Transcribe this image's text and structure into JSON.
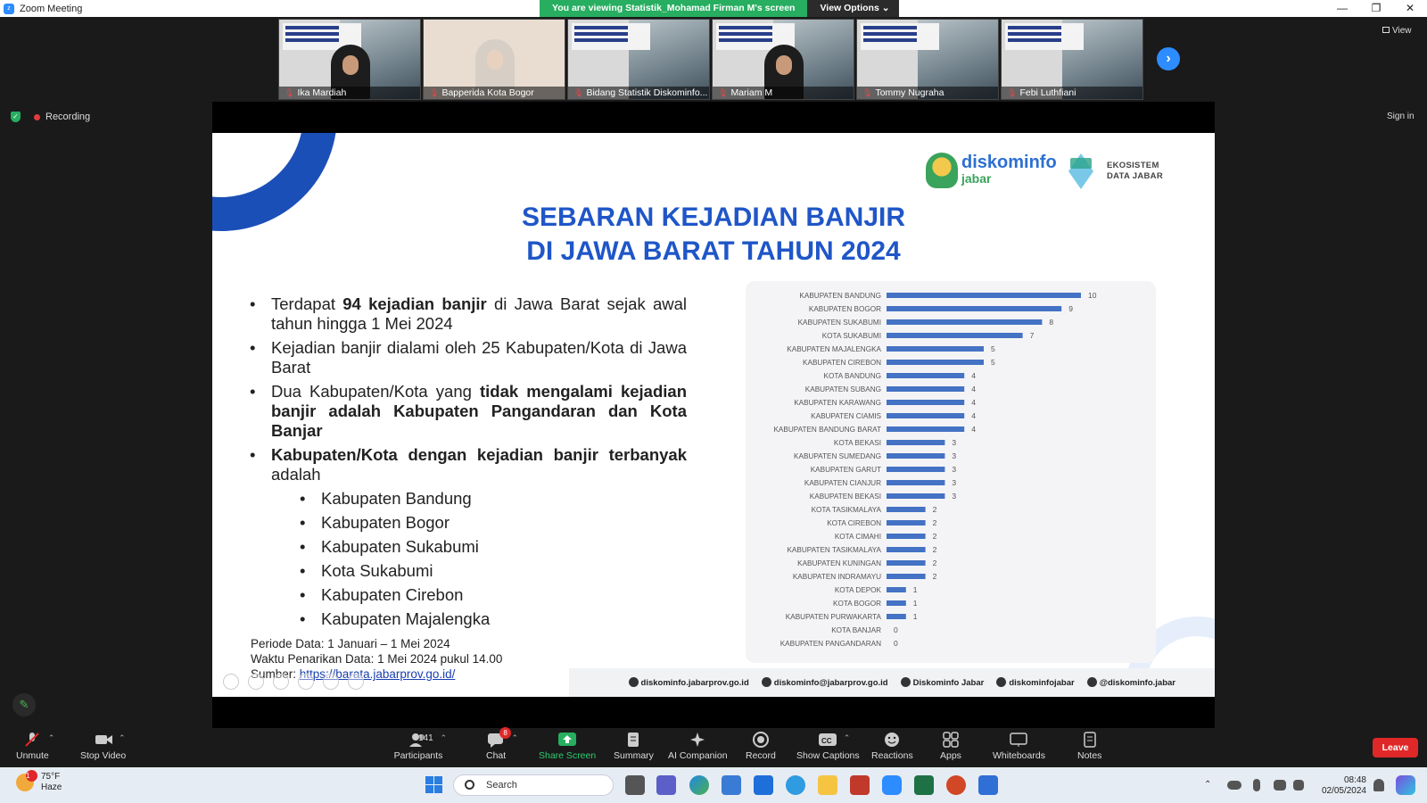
{
  "window": {
    "title": "Zoom Meeting",
    "controls": [
      "—",
      "❐",
      "✕"
    ]
  },
  "share_banner": {
    "message": "You are viewing Statistik_Mohamad Firman M's screen",
    "view_options": "View Options"
  },
  "participants_strip": [
    {
      "name": "Ika Mardiah",
      "type": "slide-person"
    },
    {
      "name": "Bapperida Kota Bogor",
      "type": "webcam"
    },
    {
      "name": "Bidang Statistik Diskominfo...",
      "type": "slide"
    },
    {
      "name": "Mariam M",
      "type": "slide-person"
    },
    {
      "name": "Tommy Nugraha",
      "type": "slide"
    },
    {
      "name": "Febi Luthfiani",
      "type": "slide"
    }
  ],
  "top_right": {
    "view_label": "View",
    "sign_in": "Sign in"
  },
  "status": {
    "recording_label": "Recording"
  },
  "slide": {
    "title_line1": "SEBARAN KEJADIAN BANJIR",
    "title_line2": "DI JAWA BARAT TAHUN 2024",
    "logo1": {
      "main": "diskominfo",
      "sub": "jabar"
    },
    "logo2": {
      "line1": "EKOSISTEM",
      "line2": "DATA JABAR"
    },
    "bullets": [
      {
        "pre": "Terdapat ",
        "bold": "94 kejadian banjir",
        "post": " di Jawa Barat sejak awal tahun hingga 1 Mei 2024"
      },
      {
        "pre": "Kejadian banjir dialami oleh 25 Kabupaten/Kota di Jawa Barat",
        "bold": "",
        "post": ""
      },
      {
        "pre": "Dua Kabupaten/Kota yang ",
        "bold": "tidak mengalami kejadian banjir adalah Kabupaten Pangandaran dan Kota Banjar",
        "post": ""
      },
      {
        "pre": "",
        "bold": "Kabupaten/Kota dengan kejadian banjir terbanyak",
        "post": " adalah"
      }
    ],
    "sub_bullets": [
      "Kabupaten Bandung",
      "Kabupaten Bogor",
      "Kabupaten Sukabumi",
      "Kota Sukabumi",
      "Kabupaten Cirebon",
      "Kabupaten Majalengka"
    ],
    "period": "Periode Data: 1 Januari – 1 Mei 2024",
    "pull_time": "Waktu Penarikan Data: 1 Mei 2024 pukul 14.00",
    "source_label": "Sumber: ",
    "source_url": "https://barata.jabarprov.go.id/",
    "footer": [
      "diskominfo.jabarprov.go.id",
      "diskominfo@jabarprov.go.id",
      "Diskominfo Jabar",
      "diskominfojabar",
      "@diskominfo.jabar"
    ]
  },
  "chart_data": {
    "type": "bar",
    "orientation": "horizontal",
    "categories": [
      "KABUPATEN BANDUNG",
      "KABUPATEN BOGOR",
      "KABUPATEN SUKABUMI",
      "KOTA SUKABUMI",
      "KABUPATEN MAJALENGKA",
      "KABUPATEN CIREBON",
      "KOTA BANDUNG",
      "KABUPATEN SUBANG",
      "KABUPATEN KARAWANG",
      "KABUPATEN CIAMIS",
      "KABUPATEN BANDUNG BARAT",
      "KOTA BEKASI",
      "KABUPATEN SUMEDANG",
      "KABUPATEN GARUT",
      "KABUPATEN CIANJUR",
      "KABUPATEN BEKASI",
      "KOTA TASIKMALAYA",
      "KOTA CIREBON",
      "KOTA CIMAHI",
      "KABUPATEN TASIKMALAYA",
      "KABUPATEN KUNINGAN",
      "KABUPATEN INDRAMAYU",
      "KOTA DEPOK",
      "KOTA BOGOR",
      "KABUPATEN PURWAKARTA",
      "KOTA BANJAR",
      "KABUPATEN PANGANDARAN"
    ],
    "values": [
      10,
      9,
      8,
      7,
      5,
      5,
      4,
      4,
      4,
      4,
      4,
      3,
      3,
      3,
      3,
      3,
      2,
      2,
      2,
      2,
      2,
      2,
      1,
      1,
      1,
      0,
      0
    ],
    "xlim": [
      0,
      10
    ],
    "bar_color": "#4472c4",
    "grid": false
  },
  "toolbar": {
    "unmute": "Unmute",
    "stop_video": "Stop Video",
    "participants": "Participants",
    "participants_count": "141",
    "chat": "Chat",
    "chat_badge": "8",
    "share_screen": "Share Screen",
    "summary": "Summary",
    "ai_companion": "AI Companion",
    "record": "Record",
    "show_captions": "Show Captions",
    "reactions": "Reactions",
    "apps": "Apps",
    "whiteboards": "Whiteboards",
    "notes": "Notes",
    "leave": "Leave"
  },
  "taskbar": {
    "weather_temp": "75°F",
    "weather_desc": "Haze",
    "weather_badge": "1",
    "search_placeholder": "Search",
    "time": "08:48",
    "date": "02/05/2024"
  },
  "colors": {
    "accent": "#2d8cff",
    "share_green": "#27ae60",
    "leave_red": "#e02828",
    "title_blue": "#1f56c8"
  }
}
